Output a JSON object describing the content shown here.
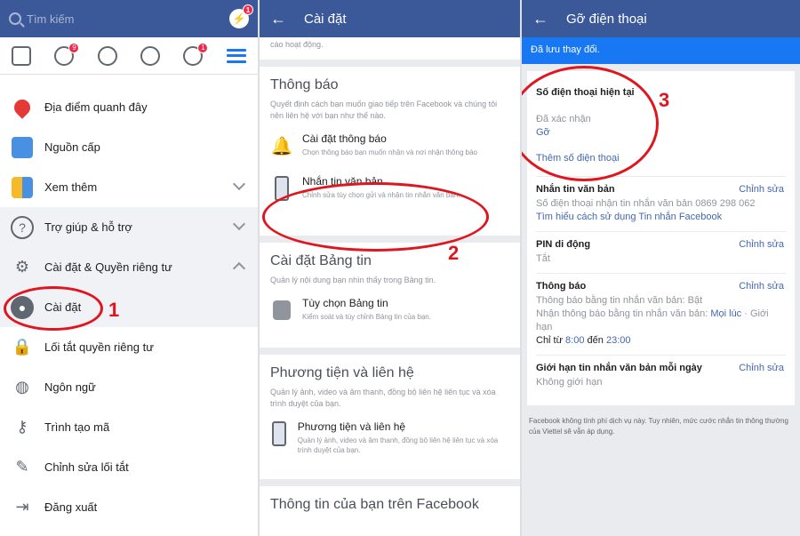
{
  "panel1": {
    "search_placeholder": "Tìm kiếm",
    "messenger_badge": "1",
    "nav_badges": {
      "friends": "9",
      "notifications": "1"
    },
    "menu": [
      {
        "label": "Địa điểm quanh đây",
        "icon": "map-pin-icon"
      },
      {
        "label": "Nguồn cấp",
        "icon": "news-feed-icon"
      },
      {
        "label": "Xem thêm",
        "icon": "see-more-icon"
      },
      {
        "label": "Trợ giúp & hỗ trợ",
        "icon": "help-icon"
      },
      {
        "label": "Cài đặt & Quyền riêng tư",
        "icon": "gear-icon"
      },
      {
        "label": "Cài đặt",
        "icon": "user-settings-icon"
      },
      {
        "label": "Lối tắt quyền riêng tư",
        "icon": "lock-icon"
      },
      {
        "label": "Ngôn ngữ",
        "icon": "globe-icon"
      },
      {
        "label": "Trình tạo mã",
        "icon": "key-icon"
      },
      {
        "label": "Chỉnh sửa lối tắt",
        "icon": "pencil-icon"
      },
      {
        "label": "Đăng xuất",
        "icon": "logout-icon"
      }
    ],
    "annotation": "1"
  },
  "panel2": {
    "title": "Cài đặt",
    "top_snippet": "cáo hoạt động.",
    "thongbao": {
      "title": "Thông báo",
      "desc": "Quyết định cách bạn muốn giao tiếp trên Facebook và chúng tôi nên liên hệ với bạn như thế nào.",
      "items": [
        {
          "title": "Cài đặt thông báo",
          "sub": "Chọn thông báo bạn muốn nhận và nơi nhận thông báo"
        },
        {
          "title": "Nhắn tin văn bản",
          "sub": "Chỉnh sửa tùy chọn gửi và nhận tin nhắn văn bản."
        }
      ]
    },
    "bangtin": {
      "title": "Cài đặt Bảng tin",
      "desc": "Quản lý nội dung bạn nhìn thấy trong Bảng tin.",
      "items": [
        {
          "title": "Tùy chọn Bảng tin",
          "sub": "Kiểm soát và tùy chỉnh Bảng tin của bạn."
        }
      ]
    },
    "phuongtien": {
      "title": "Phương tiện và liên hệ",
      "desc": "Quản lý ảnh, video và âm thanh, đồng bộ liên hệ liên tục và xóa trình duyệt của bạn.",
      "items": [
        {
          "title": "Phương tiện và liên hệ",
          "sub": "Quản lý ảnh, video và âm thanh, đồng bộ liên hệ liên tục và xóa trình duyệt của bạn."
        }
      ]
    },
    "thongtin_title": "Thông tin của bạn trên Facebook",
    "annotation": "2"
  },
  "panel3": {
    "title": "Gỡ điện thoại",
    "saved": "Đã lưu thay đổi.",
    "phone_title": "Số điện thoại hiện tại",
    "phone_status": "Đã xác nhận",
    "phone_remove": "Gỡ",
    "phone_add": "Thêm số điện thoại",
    "sms": {
      "title": "Nhắn tin văn bản",
      "edit": "Chỉnh sửa",
      "line1": "Số điện thoại nhận tin nhắn văn bản 0869 298 062",
      "link": "Tìm hiểu cách sử dụng Tin nhắn Facebook"
    },
    "pin": {
      "title": "PIN di động",
      "edit": "Chỉnh sửa",
      "value": "Tắt"
    },
    "notif": {
      "title": "Thông báo",
      "edit": "Chỉnh sửa",
      "line1": "Thông báo bằng tin nhắn văn bản: Bật",
      "line2_pre": "Nhận thông báo bằng tin nhắn văn bản:",
      "line2_link": "Mọi lúc",
      "line2_post": "· Giới hạn",
      "line3_pre": "Chỉ từ",
      "from": "8:00",
      "mid": "đến",
      "to": "23:00"
    },
    "limit": {
      "title": "Giới hạn tin nhắn văn bản mỗi ngày",
      "edit": "Chỉnh sửa",
      "value": "Không giới hạn"
    },
    "footer": "Facebook không tính phí dịch vụ này. Tuy nhiên, mức cước nhắn tin thông thường của Viettel sẽ vẫn áp dụng.",
    "annotation": "3"
  },
  "colors": {
    "fb_blue": "#3b5998",
    "annotation_red": "#e0161f",
    "link": "#4267b2"
  }
}
